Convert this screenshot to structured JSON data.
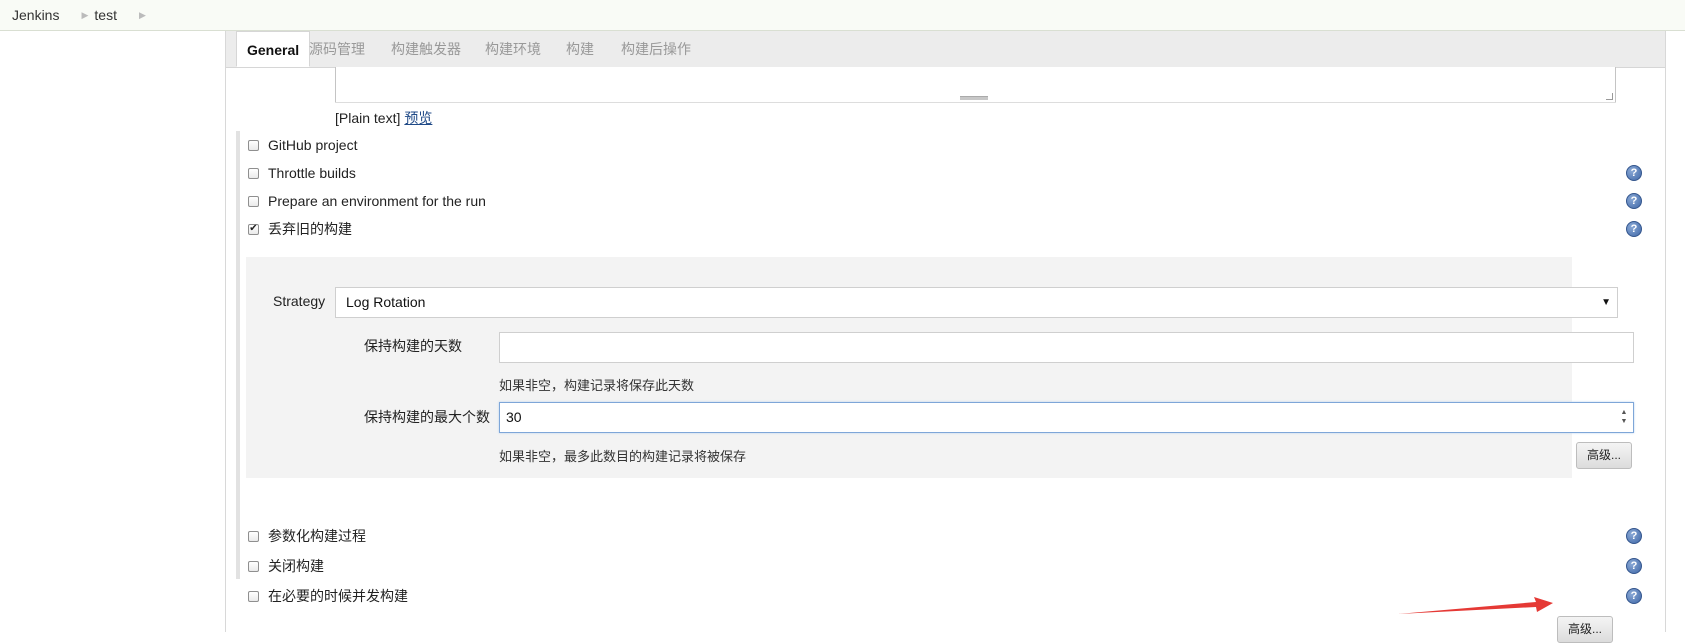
{
  "breadcrumb": {
    "items": [
      "Jenkins",
      "test"
    ]
  },
  "tabs": [
    "General",
    "源码管理",
    "构建触发器",
    "构建环境",
    "构建",
    "构建后操作"
  ],
  "description": {
    "format_text": "[Plain text]",
    "preview_link": "预览"
  },
  "options_top": [
    {
      "label": "GitHub project",
      "checked": false,
      "help": false
    },
    {
      "label": "Throttle builds",
      "checked": false,
      "help": true
    },
    {
      "label": "Prepare an environment for the run",
      "checked": false,
      "help": true
    },
    {
      "label": "丢弃旧的构建",
      "checked": true,
      "help": true
    }
  ],
  "discard": {
    "strategy_label": "Strategy",
    "strategy_value": "Log Rotation",
    "days_label": "保持构建的天数",
    "days_value": "",
    "days_hint": "如果非空，构建记录将保存此天数",
    "max_label": "保持构建的最大个数",
    "max_value": "30",
    "max_hint": "如果非空，最多此数目的构建记录将被保存",
    "advanced_button": "高级..."
  },
  "options_bottom": [
    {
      "label": "参数化构建过程",
      "checked": false,
      "help": true
    },
    {
      "label": "关闭构建",
      "checked": false,
      "help": true
    },
    {
      "label": "在必要的时候并发构建",
      "checked": false,
      "help": true
    }
  ],
  "general_advanced_button": "高级...",
  "colors": {
    "annotation_arrow": "#e53935",
    "help_icon": "#3f67a7",
    "focus_border": "#7ea6d8"
  }
}
